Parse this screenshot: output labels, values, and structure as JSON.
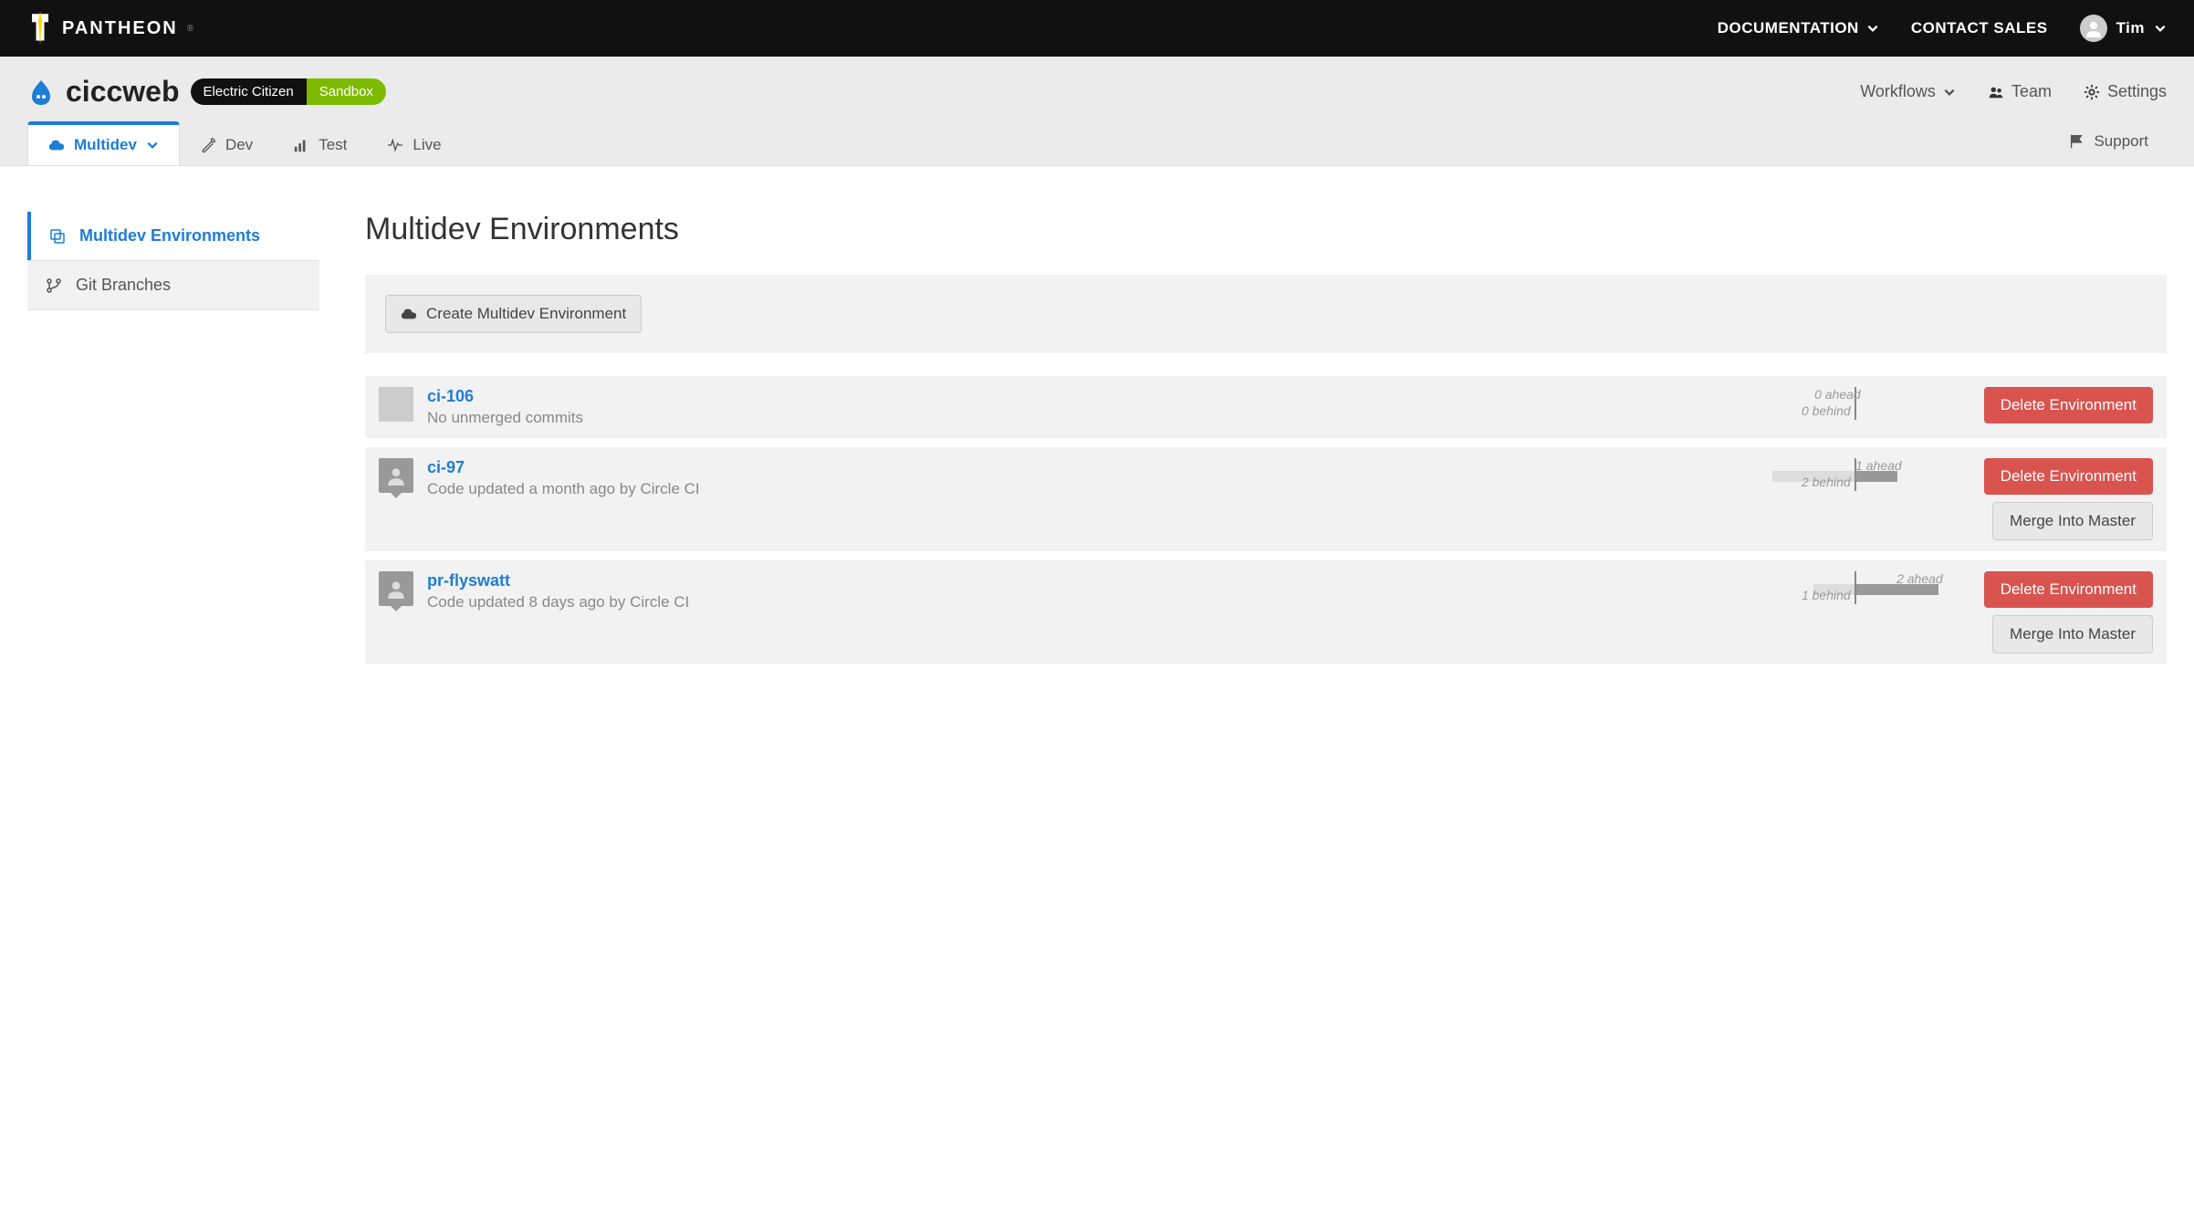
{
  "header": {
    "brand": "PANTHEON",
    "nav": {
      "documentation": "DOCUMENTATION",
      "contact_sales": "CONTACT SALES",
      "user_name": "Tim"
    }
  },
  "site": {
    "name": "ciccweb",
    "org_label": "Electric Citizen",
    "plan_label": "Sandbox",
    "actions": {
      "workflows": "Workflows",
      "team": "Team",
      "settings": "Settings"
    }
  },
  "env_tabs": {
    "multidev": "Multidev",
    "dev": "Dev",
    "test": "Test",
    "live": "Live",
    "support": "Support"
  },
  "sidebar": {
    "multidev_environments": "Multidev Environments",
    "git_branches": "Git Branches"
  },
  "page": {
    "title": "Multidev Environments",
    "create_button": "Create Multidev Environment",
    "delete_button": "Delete Environment",
    "merge_button": "Merge Into Master"
  },
  "environments": [
    {
      "name": "ci-106",
      "status": "No unmerged commits",
      "ahead": 0,
      "behind": 0,
      "ahead_label": "0 ahead",
      "behind_label": "0 behind",
      "has_avatar": false,
      "can_merge": false
    },
    {
      "name": "ci-97",
      "status": "Code updated a month ago by Circle CI",
      "ahead": 1,
      "behind": 2,
      "ahead_label": "1 ahead",
      "behind_label": "2 behind",
      "has_avatar": true,
      "can_merge": true
    },
    {
      "name": "pr-flyswatt",
      "status": "Code updated 8 days ago by Circle CI",
      "ahead": 2,
      "behind": 1,
      "ahead_label": "2 ahead",
      "behind_label": "1 behind",
      "has_avatar": true,
      "can_merge": true
    }
  ]
}
